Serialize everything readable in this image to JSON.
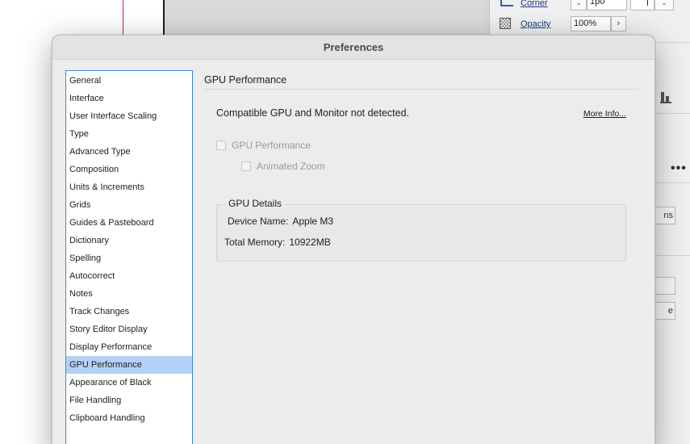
{
  "background_app": {
    "corner_label": "Corner",
    "corner_value": "1p0",
    "corner_dropdown_glyph": "⌄",
    "opacity_label": "Opacity",
    "opacity_value": "100%",
    "opacity_arrow_glyph": "›",
    "more_glyph": "•••",
    "stub_button_1": "ns",
    "stub_button_2": "",
    "stub_button_3": "e"
  },
  "dialog": {
    "title": "Preferences",
    "categories": [
      "General",
      "Interface",
      "User Interface Scaling",
      "Type",
      "Advanced Type",
      "Composition",
      "Units & Increments",
      "Grids",
      "Guides & Pasteboard",
      "Dictionary",
      "Spelling",
      "Autocorrect",
      "Notes",
      "Track Changes",
      "Story Editor Display",
      "Display Performance",
      "GPU Performance",
      "Appearance of Black",
      "File Handling",
      "Clipboard Handling"
    ],
    "selected_category": "GPU Performance",
    "panel": {
      "title": "GPU Performance",
      "message": "Compatible GPU and Monitor not detected.",
      "more_info_link": "More Info...",
      "gpu_performance_checkbox": "GPU Performance",
      "animated_zoom_checkbox": "Animated Zoom",
      "gpu_details": {
        "legend": "GPU Details",
        "device_name_label": "Device Name:",
        "device_name_value": "Apple M3",
        "total_memory_label": "Total Memory:",
        "total_memory_value": "10922MB"
      }
    }
  }
}
